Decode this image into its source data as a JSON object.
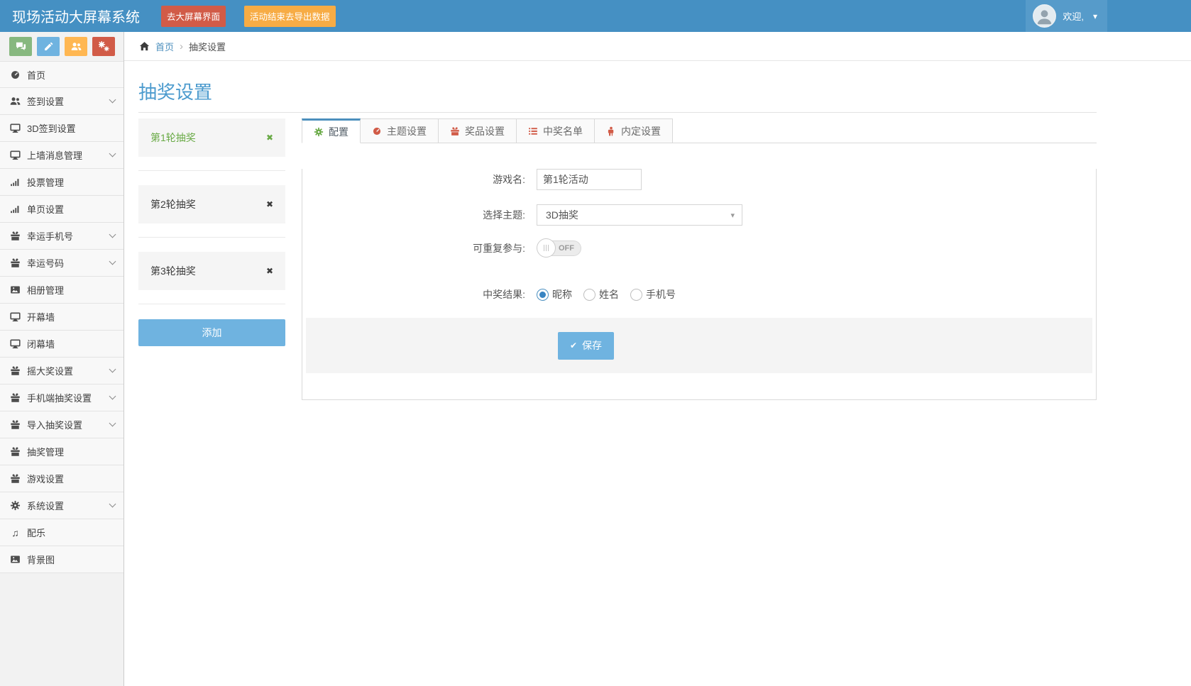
{
  "navbar": {
    "title": "现场活动大屏幕系统",
    "big_screen_button": "去大屏幕界面",
    "export_button": "活动结束去导出数据",
    "welcome": "欢迎,",
    "avatar_icon": "user-avatar",
    "caret_icon": "chevron-down-icon"
  },
  "breadcrumb": {
    "home_icon": "home-icon",
    "home": "首页",
    "separator": "›",
    "current": "抽奖设置"
  },
  "sidebar": {
    "quick_buttons": [
      {
        "icon": "comments-icon",
        "color": "#87b87f"
      },
      {
        "icon": "pencil-icon",
        "color": "#6fb3e0"
      },
      {
        "icon": "users-icon",
        "color": "#ffb752"
      },
      {
        "icon": "cogs-icon",
        "color": "#d15b47"
      }
    ],
    "items": [
      {
        "label": "首页",
        "icon": "dashboard-icon",
        "expandable": false
      },
      {
        "label": "签到设置",
        "icon": "users-icon",
        "expandable": true
      },
      {
        "label": "3D签到设置",
        "icon": "desktop-icon",
        "expandable": false
      },
      {
        "label": "上墙消息管理",
        "icon": "desktop-icon",
        "expandable": true
      },
      {
        "label": "投票管理",
        "icon": "bar-chart-icon",
        "expandable": false
      },
      {
        "label": "单页设置",
        "icon": "bar-chart-icon",
        "expandable": false
      },
      {
        "label": "幸运手机号",
        "icon": "gift-icon",
        "expandable": true
      },
      {
        "label": "幸运号码",
        "icon": "gift-icon",
        "expandable": true
      },
      {
        "label": "相册管理",
        "icon": "image-icon",
        "expandable": false
      },
      {
        "label": "开幕墙",
        "icon": "desktop-icon",
        "expandable": false
      },
      {
        "label": "闭幕墙",
        "icon": "desktop-icon",
        "expandable": false
      },
      {
        "label": "摇大奖设置",
        "icon": "gift-icon",
        "expandable": true
      },
      {
        "label": "手机端抽奖设置",
        "icon": "gift-icon",
        "expandable": true
      },
      {
        "label": "导入抽奖设置",
        "icon": "gift-icon",
        "expandable": true
      },
      {
        "label": "抽奖管理",
        "icon": "gift-icon",
        "expandable": false
      },
      {
        "label": "游戏设置",
        "icon": "gift-icon",
        "expandable": false
      },
      {
        "label": "系统设置",
        "icon": "gear-icon",
        "expandable": true
      },
      {
        "label": "配乐",
        "icon": "music-icon",
        "expandable": false
      },
      {
        "label": "背景图",
        "icon": "image-icon",
        "expandable": false
      }
    ]
  },
  "page": {
    "title": "抽奖设置"
  },
  "rounds": {
    "items": [
      {
        "label": "第1轮抽奖",
        "active": true,
        "delete_icon": "close-icon"
      },
      {
        "label": "第2轮抽奖",
        "active": false,
        "delete_icon": "close-icon"
      },
      {
        "label": "第3轮抽奖",
        "active": false,
        "delete_icon": "close-icon"
      }
    ],
    "add_button": "添加"
  },
  "tabs": [
    {
      "label": "配置",
      "icon": "gear-icon",
      "active": true
    },
    {
      "label": "主题设置",
      "icon": "dashboard-icon",
      "active": false
    },
    {
      "label": "奖品设置",
      "icon": "gift-icon",
      "active": false
    },
    {
      "label": "中奖名单",
      "icon": "list-icon",
      "active": false
    },
    {
      "label": "内定设置",
      "icon": "person-icon",
      "active": false
    }
  ],
  "form": {
    "game_name": {
      "label": "游戏名:",
      "value": "第1轮活动"
    },
    "theme": {
      "label": "选择主题:",
      "value": "3D抽奖",
      "caret_icon": "chevron-down-icon"
    },
    "repeat": {
      "label": "可重复参与:",
      "state": "OFF"
    },
    "result": {
      "label": "中奖结果:",
      "options": [
        "昵称",
        "姓名",
        "手机号"
      ],
      "selected": "昵称"
    },
    "save_button": "保存",
    "save_icon": "check-icon"
  },
  "colors": {
    "navbar": "#4590c3",
    "danger": "#d15b47",
    "warning": "#f7ac45",
    "info_button": "#6fb3e0",
    "success_text": "#69aa46",
    "link": "#4c8fbd",
    "title": "#4c9bce",
    "tab_active_bar": "#4c8fbd",
    "sidebar_bg": "#f2f2f2",
    "radio_selected": "#3884c2"
  }
}
